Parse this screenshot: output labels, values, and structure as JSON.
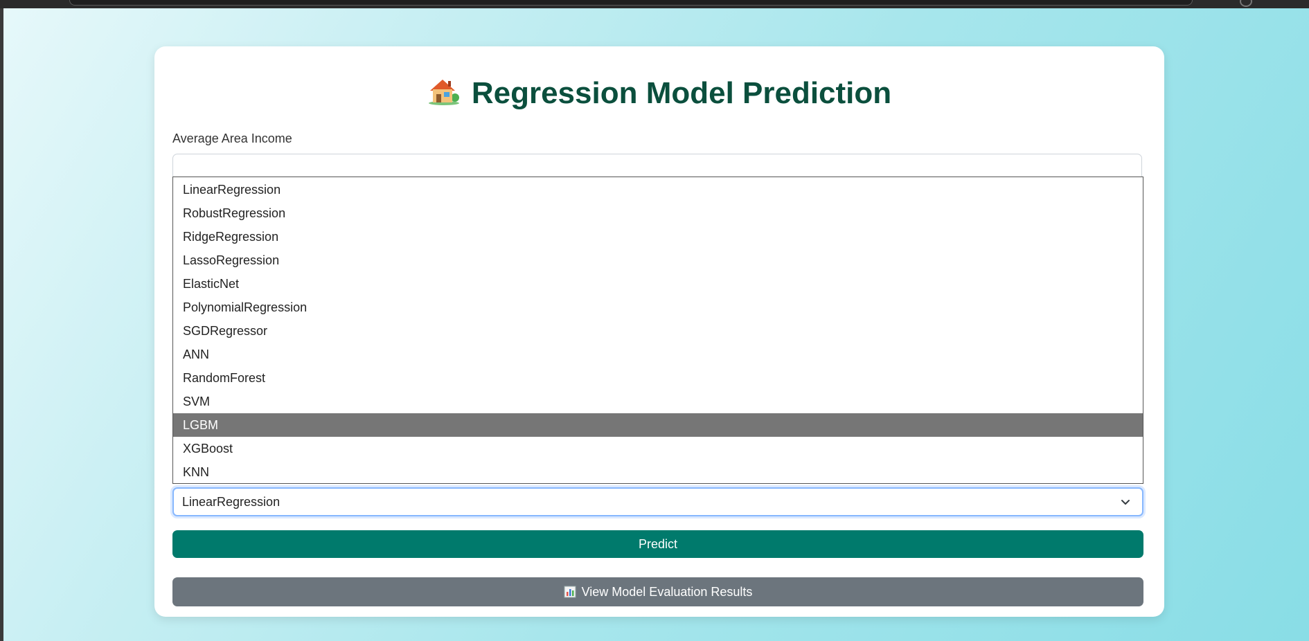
{
  "page": {
    "title": "Regression Model Prediction",
    "title_icon": "house-icon"
  },
  "form": {
    "income_label": "Average Area Income",
    "income_value": "",
    "model_select": {
      "selected": "LinearRegression",
      "highlighted": "LGBM",
      "options": [
        "LinearRegression",
        "RobustRegression",
        "RidgeRegression",
        "LassoRegression",
        "ElasticNet",
        "PolynomialRegression",
        "SGDRegressor",
        "ANN",
        "RandomForest",
        "SVM",
        "LGBM",
        "XGBoost",
        "KNN"
      ]
    },
    "predict_label": "Predict",
    "eval_label": "View Model Evaluation Results",
    "eval_icon": "bar-chart-icon"
  },
  "colors": {
    "title": "#0b4f3d",
    "predict_button": "#007a6c",
    "eval_button": "#6c757d",
    "highlighted_option": "#767676",
    "background_start": "#e6f8fa",
    "background_end": "#89dde6"
  }
}
